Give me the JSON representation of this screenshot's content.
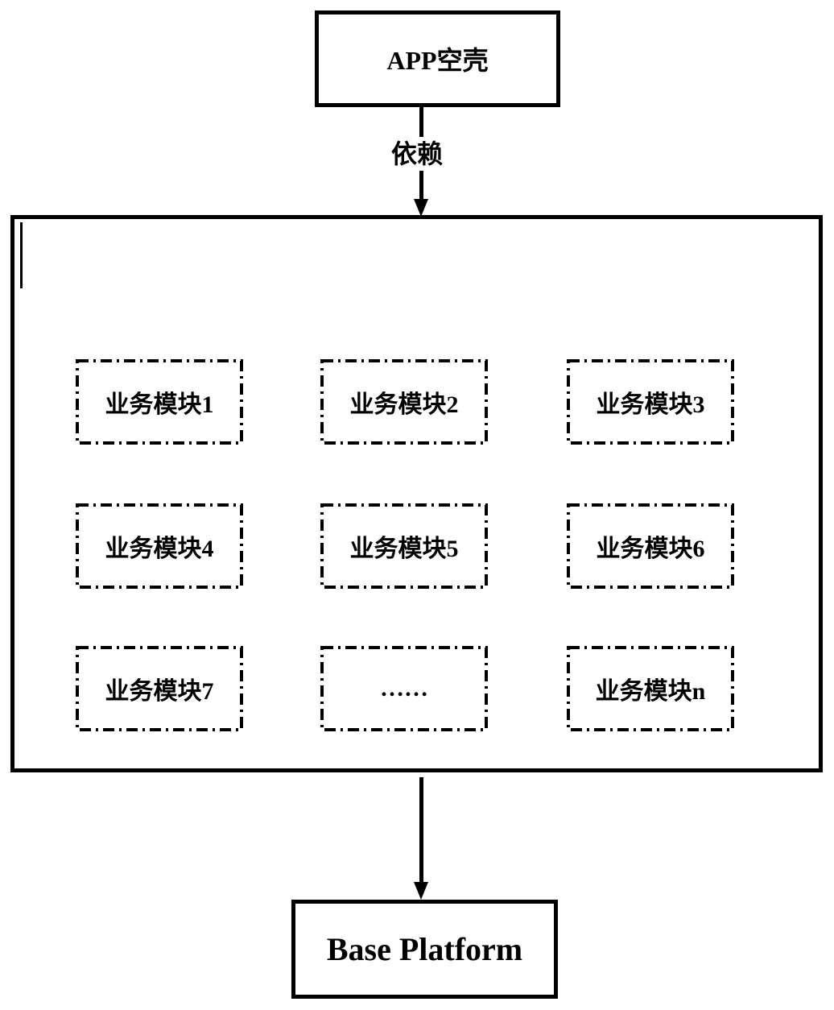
{
  "top_box": {
    "label": "APP空壳"
  },
  "dependency_label": "依赖",
  "container": {
    "modules": [
      {
        "label": "业务模块1"
      },
      {
        "label": "业务模块2"
      },
      {
        "label": "业务模块3"
      },
      {
        "label": "业务模块4"
      },
      {
        "label": "业务模块5"
      },
      {
        "label": "业务模块6"
      },
      {
        "label": "业务模块7"
      },
      {
        "label": "……"
      },
      {
        "label": "业务模块n"
      }
    ]
  },
  "bottom_box": {
    "label": "Base Platform"
  }
}
